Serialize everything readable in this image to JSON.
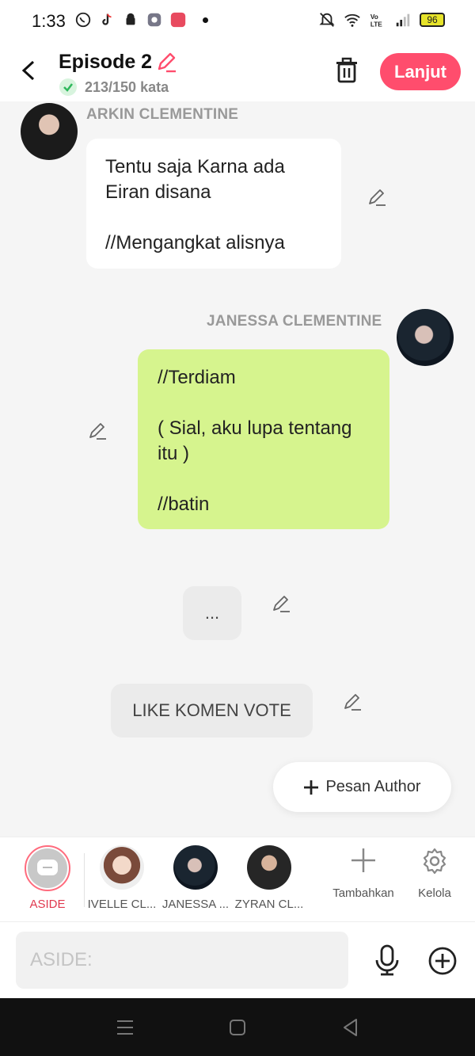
{
  "status_bar": {
    "time": "1:33",
    "battery": "96"
  },
  "header": {
    "title": "Episode 2",
    "word_count": "213/150 kata",
    "next_label": "Lanjut"
  },
  "messages": [
    {
      "sender": "ARKIN CLEMENTINE",
      "text": "Tentu saja Karna ada\nEiran disana\n\n//Mengangkat alisnya"
    },
    {
      "sender": "JANESSA CLEMENTINE",
      "text": "//Terdiam\n\n( Sial, aku lupa tentang\nitu )\n\n//batin"
    },
    {
      "text": "..."
    },
    {
      "text": "LIKE KOMEN VOTE"
    }
  ],
  "author_button": "Pesan Author",
  "characters": [
    {
      "label": "ASIDE",
      "active": true
    },
    {
      "label": "IVELLE CL..."
    },
    {
      "label": "JANESSA ..."
    },
    {
      "label": "ZYRAN CL..."
    },
    {
      "label": "Tambahkan"
    },
    {
      "label": "Kelola"
    }
  ],
  "input": {
    "placeholder": "ASIDE:"
  },
  "colors": {
    "accent": "#ff4d6d",
    "green_bubble": "#d6f48e",
    "aside_label": "#e0394f"
  }
}
